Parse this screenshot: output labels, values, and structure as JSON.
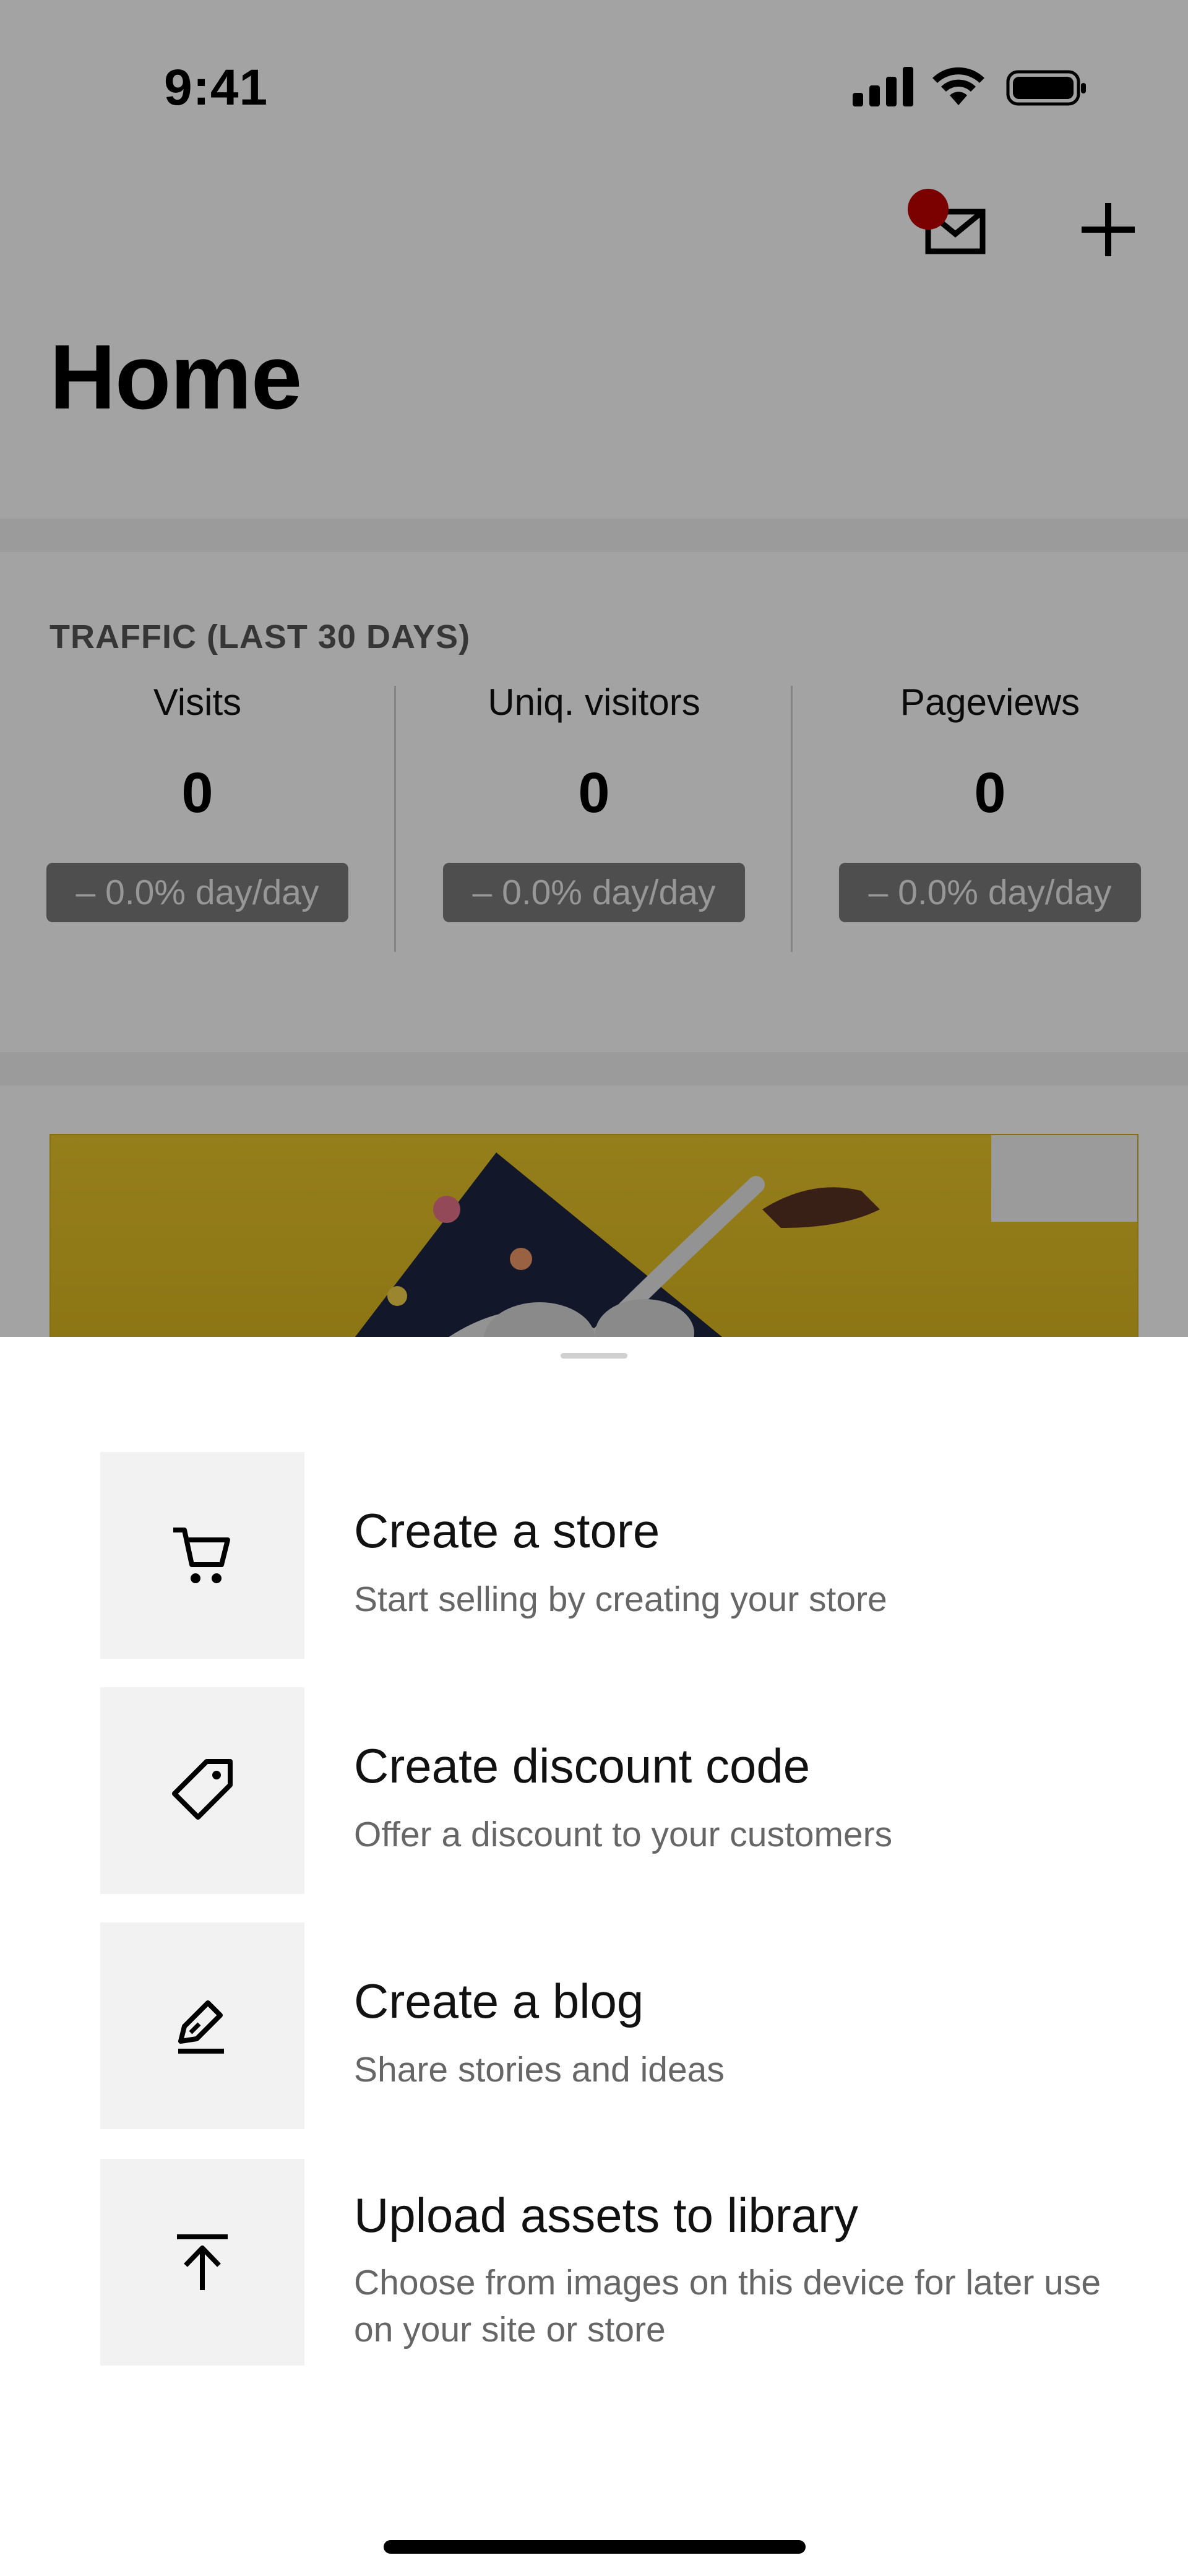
{
  "status_bar": {
    "time": "9:41"
  },
  "header": {
    "title": "Home"
  },
  "traffic": {
    "heading": "TRAFFIC  (LAST 30 DAYS)",
    "stats": [
      {
        "label": "Visits",
        "value": "0",
        "change": "–  0.0% day/day"
      },
      {
        "label": "Uniq. visitors",
        "value": "0",
        "change": "–  0.0% day/day"
      },
      {
        "label": "Pageviews",
        "value": "0",
        "change": "–  0.0% day/day"
      }
    ]
  },
  "sheet": {
    "actions": [
      {
        "title": "Create a store",
        "description": "Start selling by creating your store",
        "icon": "cart-icon"
      },
      {
        "title": "Create discount code",
        "description": "Offer a discount to your customers",
        "icon": "tag-icon"
      },
      {
        "title": "Create a blog",
        "description": "Share stories and ideas",
        "icon": "pen-icon"
      },
      {
        "title": "Upload assets to library",
        "description": "Choose from images on this device for later use on your site or store",
        "icon": "upload-icon"
      }
    ]
  },
  "colors": {
    "notification_dot": "#c00000",
    "banner_yellow": "#e2bf26",
    "scrim": "rgba(0,0,0,0.36)"
  }
}
